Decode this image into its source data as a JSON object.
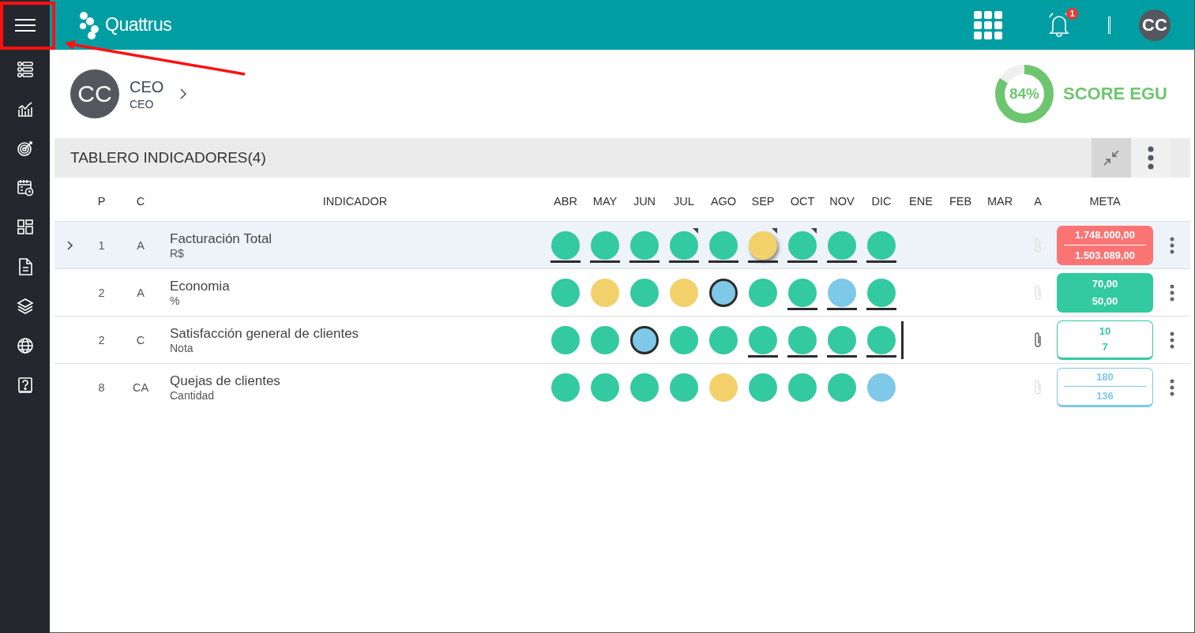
{
  "header": {
    "logo_text": "Quattrus",
    "notification_count": "1",
    "avatar_initials": "CC"
  },
  "profile": {
    "initials": "CC",
    "title": "CEO",
    "subtitle": "CEO"
  },
  "score": {
    "value": "84%",
    "label": "SCORE EGU",
    "level": 0.84
  },
  "board": {
    "title": "TABLERO INDICADORES(4)",
    "columns": [
      "P",
      "C",
      "INDICADOR",
      "ABR",
      "MAY",
      "JUN",
      "JUL",
      "AGO",
      "SEP",
      "OCT",
      "NOV",
      "DIC",
      "ENE",
      "FEB",
      "MAR",
      "A",
      "META"
    ],
    "rows": [
      {
        "expandable": true,
        "selected": true,
        "p": "1",
        "c": "A",
        "name": "Facturación Total",
        "unit": "R$",
        "attachment": false,
        "marker": false,
        "months": [
          {
            "color": "#33c9a1",
            "underline": true,
            "flag": false,
            "kind": "plain"
          },
          {
            "color": "#33c9a1",
            "underline": true,
            "flag": false,
            "kind": "plain"
          },
          {
            "color": "#33c9a1",
            "underline": true,
            "flag": false,
            "kind": "plain"
          },
          {
            "color": "#33c9a1",
            "underline": true,
            "flag": true,
            "kind": "plain"
          },
          {
            "color": "#33c9a1",
            "underline": true,
            "flag": false,
            "kind": "plain"
          },
          {
            "color": "#f2d16b",
            "underline": true,
            "flag": true,
            "kind": "raised"
          },
          {
            "color": "#33c9a1",
            "underline": true,
            "flag": true,
            "kind": "plain"
          },
          {
            "color": "#33c9a1",
            "underline": true,
            "flag": false,
            "kind": "plain"
          },
          {
            "color": "#33c9a1",
            "underline": true,
            "flag": false,
            "kind": "plain"
          }
        ],
        "meta": {
          "kind": "filled",
          "color": "#fb7474",
          "divider": true,
          "target": "1.748.000,00",
          "actual": "1.503.089,00"
        }
      },
      {
        "expandable": false,
        "selected": false,
        "p": "2",
        "c": "A",
        "name": "Economia",
        "unit": "%",
        "attachment": false,
        "marker": false,
        "months": [
          {
            "color": "#33c9a1",
            "underline": false,
            "flag": false,
            "kind": "plain"
          },
          {
            "color": "#f2d16b",
            "underline": false,
            "flag": false,
            "kind": "plain"
          },
          {
            "color": "#33c9a1",
            "underline": false,
            "flag": false,
            "kind": "plain"
          },
          {
            "color": "#f2d16b",
            "underline": false,
            "flag": false,
            "kind": "plain"
          },
          {
            "color": "#7ec8e8",
            "underline": false,
            "flag": false,
            "kind": "outlined"
          },
          {
            "color": "#33c9a1",
            "underline": false,
            "flag": false,
            "kind": "plain"
          },
          {
            "color": "#33c9a1",
            "underline": true,
            "flag": false,
            "kind": "plain"
          },
          {
            "color": "#7ec8e8",
            "underline": true,
            "flag": false,
            "kind": "plain"
          },
          {
            "color": "#33c9a1",
            "underline": true,
            "flag": false,
            "kind": "plain"
          }
        ],
        "meta": {
          "kind": "filled",
          "color": "#33c9a1",
          "divider": false,
          "target": "70,00",
          "actual": "50,00"
        }
      },
      {
        "expandable": false,
        "selected": false,
        "p": "2",
        "c": "C",
        "name": "Satisfacción general de clientes",
        "unit": "Nota",
        "attachment": true,
        "marker": true,
        "months": [
          {
            "color": "#33c9a1",
            "underline": false,
            "flag": false,
            "kind": "plain"
          },
          {
            "color": "#33c9a1",
            "underline": false,
            "flag": false,
            "kind": "plain"
          },
          {
            "color": "#7ec8e8",
            "underline": false,
            "flag": false,
            "kind": "outlined"
          },
          {
            "color": "#33c9a1",
            "underline": false,
            "flag": false,
            "kind": "plain"
          },
          {
            "color": "#33c9a1",
            "underline": false,
            "flag": false,
            "kind": "plain"
          },
          {
            "color": "#33c9a1",
            "underline": true,
            "flag": false,
            "kind": "plain"
          },
          {
            "color": "#33c9a1",
            "underline": true,
            "flag": false,
            "kind": "plain"
          },
          {
            "color": "#33c9a1",
            "underline": true,
            "flag": false,
            "kind": "plain"
          },
          {
            "color": "#33c9a1",
            "underline": true,
            "flag": false,
            "kind": "plain"
          }
        ],
        "meta": {
          "kind": "outlined",
          "color": "#33c9a1",
          "divider": false,
          "target": "10",
          "actual": "7"
        }
      },
      {
        "expandable": false,
        "selected": false,
        "p": "8",
        "c": "CA",
        "name": "Quejas de clientes",
        "unit": "Cantidad",
        "attachment": false,
        "marker": false,
        "months": [
          {
            "color": "#33c9a1",
            "underline": false,
            "flag": false,
            "kind": "plain"
          },
          {
            "color": "#33c9a1",
            "underline": false,
            "flag": false,
            "kind": "plain"
          },
          {
            "color": "#33c9a1",
            "underline": false,
            "flag": false,
            "kind": "plain"
          },
          {
            "color": "#33c9a1",
            "underline": false,
            "flag": false,
            "kind": "plain"
          },
          {
            "color": "#f2d16b",
            "underline": false,
            "flag": false,
            "kind": "plain"
          },
          {
            "color": "#33c9a1",
            "underline": false,
            "flag": false,
            "kind": "plain"
          },
          {
            "color": "#33c9a1",
            "underline": false,
            "flag": false,
            "kind": "plain"
          },
          {
            "color": "#33c9a1",
            "underline": false,
            "flag": false,
            "kind": "plain"
          },
          {
            "color": "#7ec8e8",
            "underline": false,
            "flag": false,
            "kind": "plain"
          }
        ],
        "meta": {
          "kind": "outlined",
          "color": "#7ec8e8",
          "divider": true,
          "target": "180",
          "actual": "136"
        }
      }
    ]
  },
  "annotation": {
    "highlight_menu": true
  }
}
